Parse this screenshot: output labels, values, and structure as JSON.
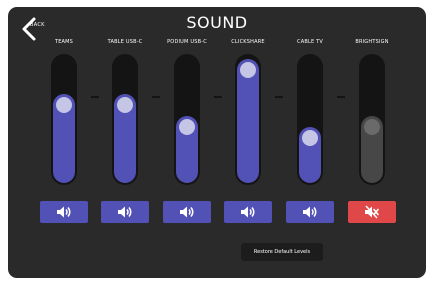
{
  "header": {
    "title": "SOUND",
    "back_label": "BACK"
  },
  "colors": {
    "panel": "#2a2a2a",
    "track": "#141414",
    "fill_active": "#5251b5",
    "fill_muted": "#474747",
    "thumb_active": "#c5c5e6",
    "thumb_muted": "#6a6a6a",
    "button_active": "#5251b5",
    "button_muted": "#e04748"
  },
  "channels": [
    {
      "label": "TEAMS",
      "level": 0.7,
      "muted": false,
      "icon": "speaker-icon"
    },
    {
      "label": "TABLE USB-C",
      "level": 0.7,
      "muted": false,
      "icon": "speaker-icon"
    },
    {
      "label": "PODIUM USB-C",
      "level": 0.53,
      "muted": false,
      "icon": "speaker-icon"
    },
    {
      "label": "CLICKSHARE",
      "level": 0.98,
      "muted": false,
      "icon": "speaker-icon"
    },
    {
      "label": "CABLE TV",
      "level": 0.44,
      "muted": false,
      "icon": "speaker-icon"
    },
    {
      "label": "BRIGHTSIGN",
      "level": 0.53,
      "muted": true,
      "icon": "speaker-muted-icon"
    }
  ],
  "restore_label": "Restore Default Levels"
}
